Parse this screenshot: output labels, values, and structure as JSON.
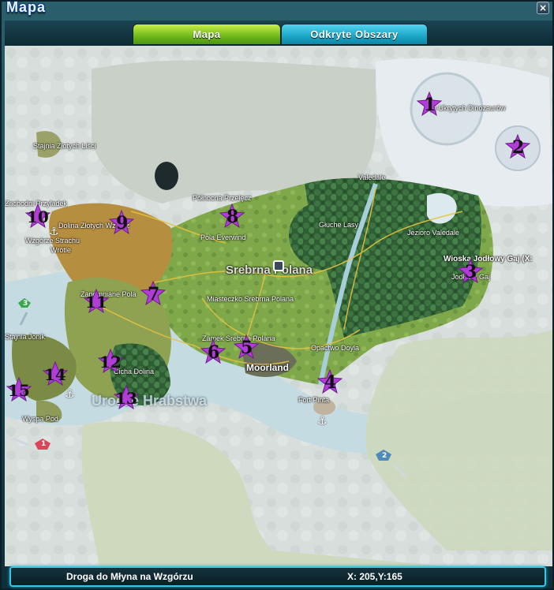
{
  "window": {
    "title": "Mapa",
    "close_glyph": "×"
  },
  "tabs": [
    {
      "label": "Mapa",
      "active": true
    },
    {
      "label": "Odkryte Obszary",
      "active": false
    }
  ],
  "map": {
    "region_labels": [
      "Stajnia Złotych Liści",
      "Zachodni Przyladek",
      "Dolina Złotych Wzgórz",
      "Wzgórze Strachu",
      "Wrótle",
      "Północna Przełęcz",
      "Pola Everwind",
      "Valedale",
      "Głuche Lasy",
      "Jezioro Valedale",
      "Wioska Jodłowy Gaj (X:",
      "Jodłowy Gaj",
      "ja Ukrytych Dinozaurów",
      "Srebrna Polana",
      "Miasteczko Srebrna Polana",
      "Zapomniane Pola",
      "Zamek Srebrna Polana",
      "Moorland",
      "Opactwo Doyla",
      "Fort Pinta",
      "Stajnia Jonik",
      "Cicha Dolina",
      "Wyspa Pod",
      "Urocze Hrabstwa"
    ],
    "markers": [
      "1",
      "2",
      "3",
      "4",
      "5",
      "6",
      "7",
      "8",
      "9",
      "10",
      "11",
      "12",
      "13",
      "14",
      "15"
    ],
    "portals": [
      "1",
      "2",
      "3"
    ],
    "icons": [
      "portal-icon",
      "anchor-icon",
      "star-marker-icon",
      "map-pin-icon"
    ]
  },
  "status": {
    "location": "Droga do Młyna na Wzgórzu",
    "coords": "X: 205,Y:165"
  },
  "colors": {
    "active_tab": "#7fc21e",
    "inactive_tab": "#1aa6c6",
    "marker": "#b23cd8",
    "status_border": "#38c5e6"
  }
}
